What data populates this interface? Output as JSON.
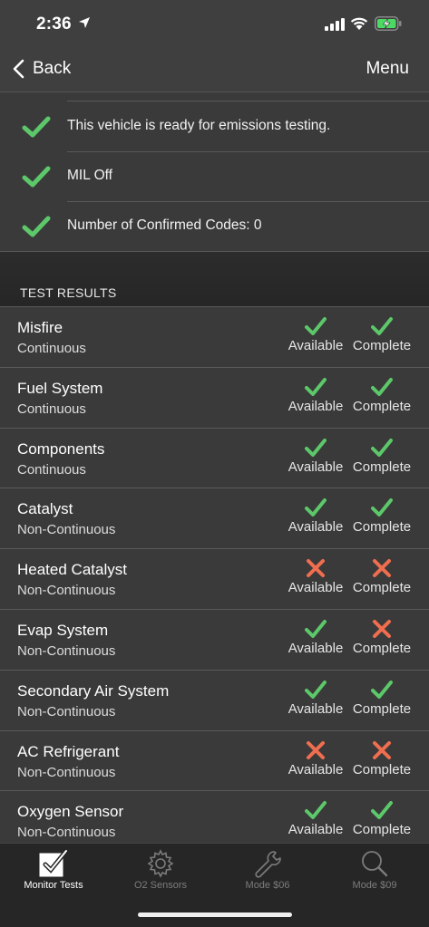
{
  "status_bar": {
    "time": "2:36",
    "battery_color": "#4cd964"
  },
  "nav": {
    "back_label": "Back",
    "menu_label": "Menu"
  },
  "summary": [
    {
      "text": "This vehicle is ready for emissions testing.",
      "ok": true
    },
    {
      "text": "MIL Off",
      "ok": true
    },
    {
      "text": "Number of Confirmed Codes: 0",
      "ok": true
    }
  ],
  "section_title": "TEST RESULTS",
  "status_labels": {
    "available": "Available",
    "complete": "Complete"
  },
  "colors": {
    "pass": "#5cc86a",
    "fail": "#f06e4f",
    "background": "#3a3a3a"
  },
  "results": [
    {
      "name": "Misfire",
      "type": "Continuous",
      "available": true,
      "complete": true
    },
    {
      "name": "Fuel System",
      "type": "Continuous",
      "available": true,
      "complete": true
    },
    {
      "name": "Components",
      "type": "Continuous",
      "available": true,
      "complete": true
    },
    {
      "name": "Catalyst",
      "type": "Non-Continuous",
      "available": true,
      "complete": true
    },
    {
      "name": "Heated Catalyst",
      "type": "Non-Continuous",
      "available": false,
      "complete": false
    },
    {
      "name": "Evap System",
      "type": "Non-Continuous",
      "available": true,
      "complete": false
    },
    {
      "name": "Secondary Air System",
      "type": "Non-Continuous",
      "available": true,
      "complete": true
    },
    {
      "name": "AC Refrigerant",
      "type": "Non-Continuous",
      "available": false,
      "complete": false
    },
    {
      "name": "Oxygen Sensor",
      "type": "Non-Continuous",
      "available": true,
      "complete": true
    }
  ],
  "tabs": [
    {
      "label": "Monitor Tests",
      "icon": "checkbox-icon",
      "active": true
    },
    {
      "label": "O2 Sensors",
      "icon": "gear-icon",
      "active": false
    },
    {
      "label": "Mode $06",
      "icon": "wrench-icon",
      "active": false
    },
    {
      "label": "Mode $09",
      "icon": "magnifier-icon",
      "active": false
    }
  ]
}
